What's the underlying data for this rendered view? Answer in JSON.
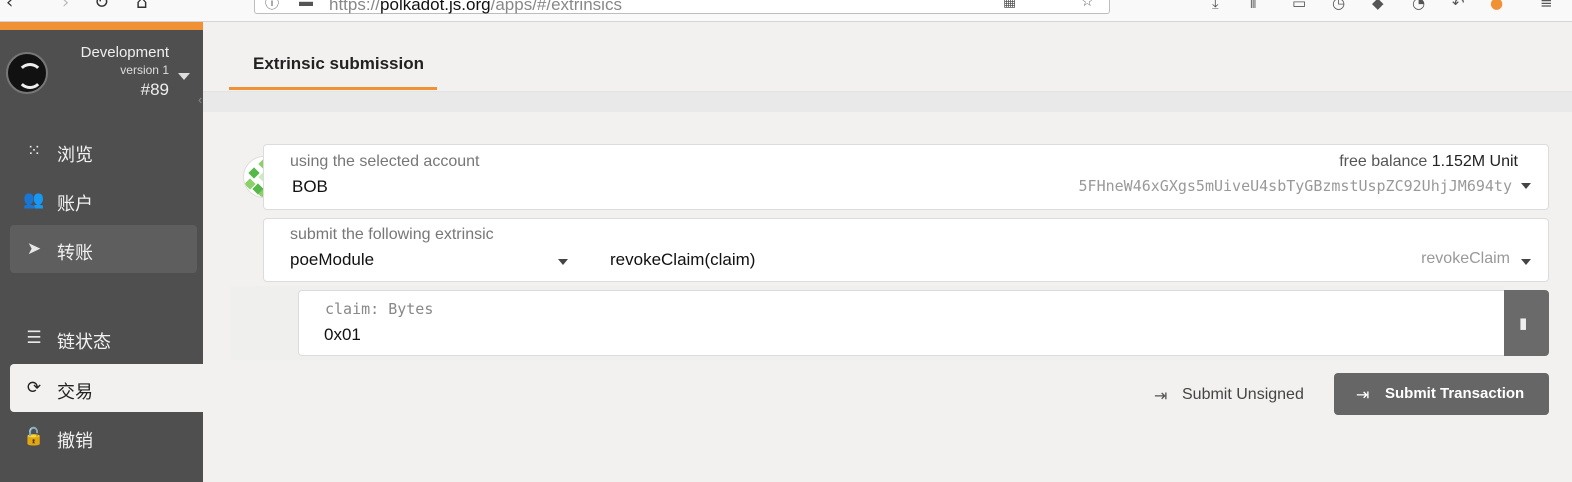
{
  "browser": {
    "url_prefix": "https://",
    "url_host": "polkadot.js.org",
    "url_path": "/apps/#/extrinsics"
  },
  "sidebar": {
    "chain_name": "Development",
    "chain_version": "version 1",
    "block_number": "#89",
    "items": [
      {
        "label": "浏览",
        "icon": "grid-dots-icon"
      },
      {
        "label": "账户",
        "icon": "users-icon"
      },
      {
        "label": "转账",
        "icon": "paper-plane-icon"
      },
      {
        "label": "链状态",
        "icon": "database-icon"
      },
      {
        "label": "交易",
        "icon": "sync-icon"
      },
      {
        "label": "撤销",
        "icon": "unlock-icon"
      }
    ]
  },
  "header": {
    "tab_label": "Extrinsic submission"
  },
  "account": {
    "label": "using the selected account",
    "name": "BOB",
    "balance_label": "free balance",
    "balance_value": "1.152M Unit",
    "address": "5FHneW46xGXgs5mUiveU4sbTyGBzmstUspZC92UhjJM694ty"
  },
  "extrinsic": {
    "label": "submit the following extrinsic",
    "module": "poeModule",
    "method": "revokeClaim(claim)",
    "method_short": "revokeClaim"
  },
  "param": {
    "label": "claim: Bytes",
    "value": "0x01"
  },
  "actions": {
    "unsigned_label": "Submit Unsigned",
    "submit_label": "Submit Transaction"
  },
  "colors": {
    "accent": "#f19135",
    "sidebar": "#4f4f50",
    "button": "#666666"
  }
}
